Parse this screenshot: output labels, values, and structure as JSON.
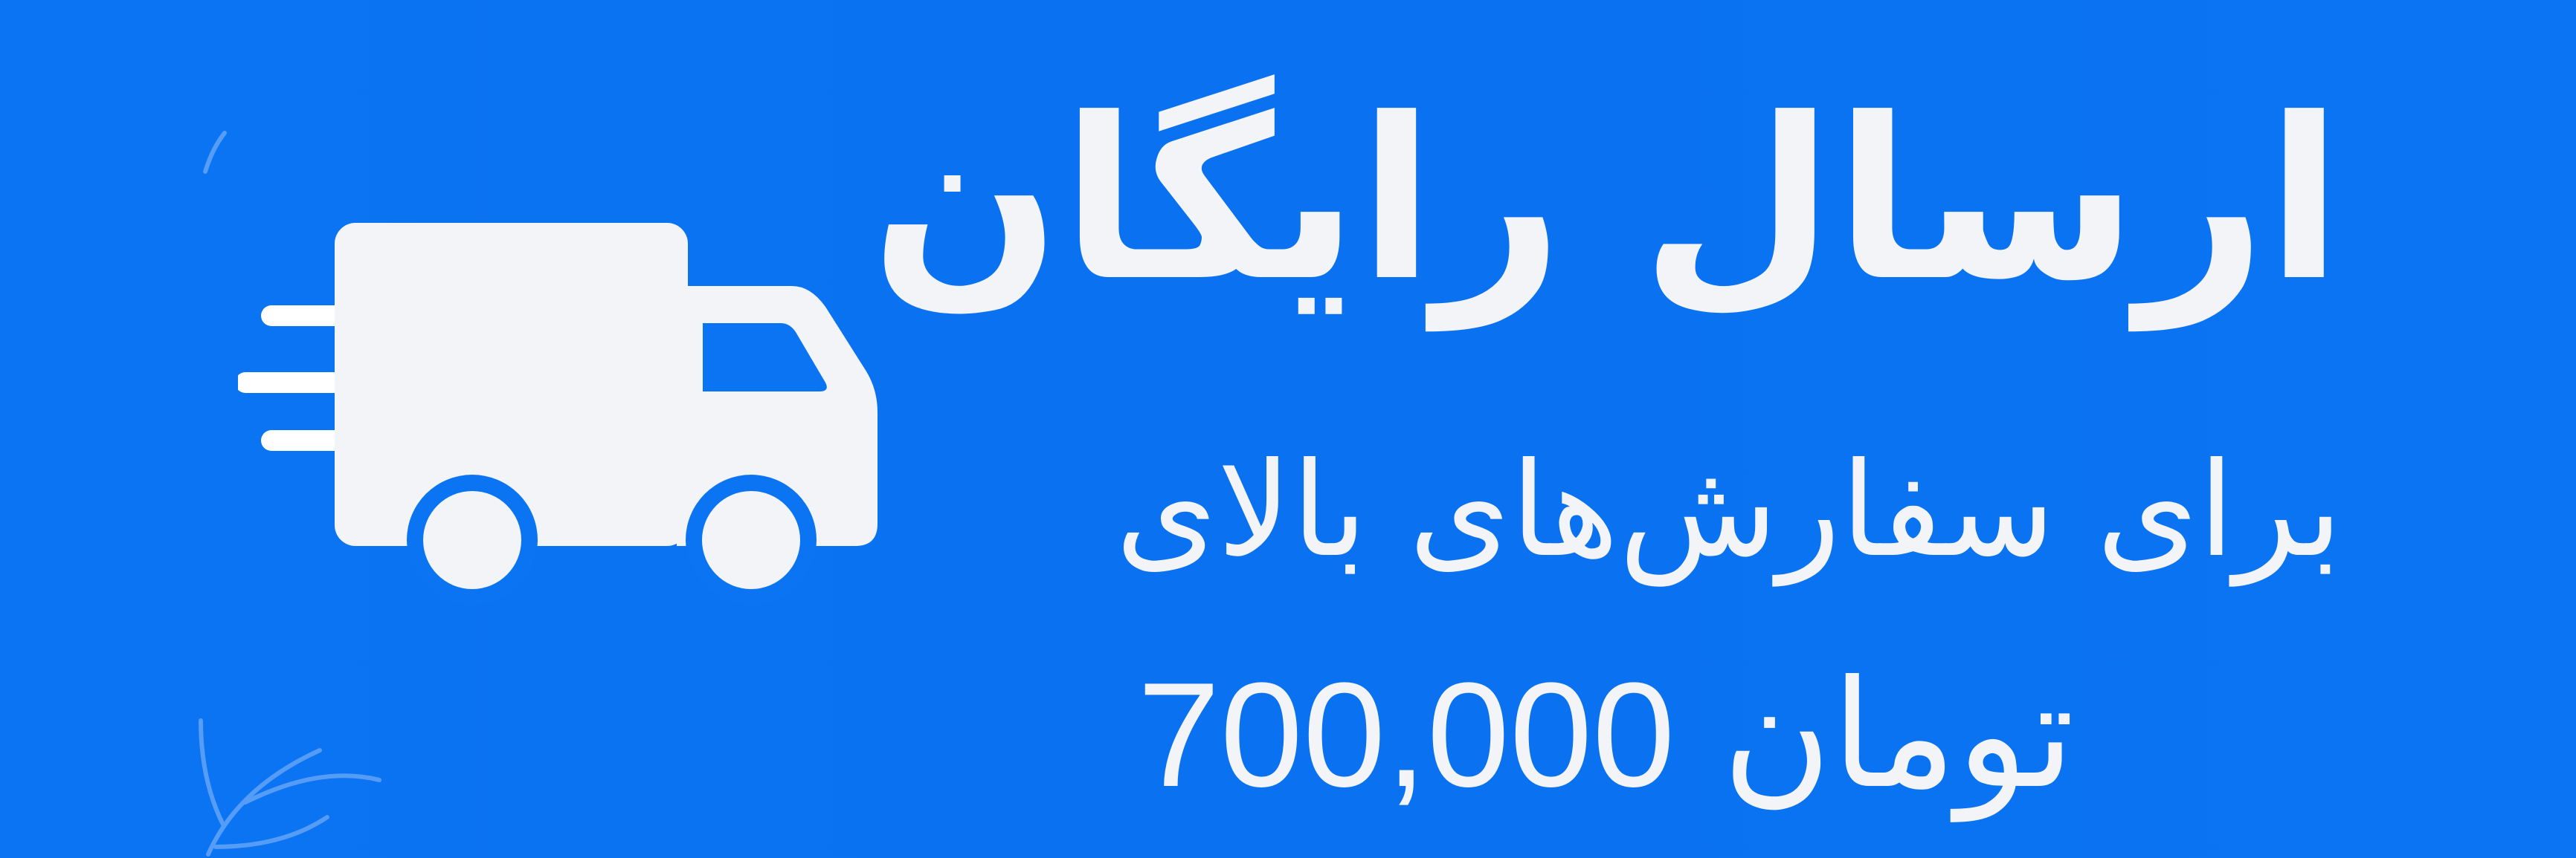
{
  "banner": {
    "headline": "ارسال رایگان",
    "subline": "برای سفارش‌های بالای",
    "amount": "700,000",
    "currency": "تومان"
  },
  "colors": {
    "background": "#0b74f2",
    "foreground": "#f3f4f8"
  },
  "icons": {
    "truck": "delivery-truck-icon",
    "leaf": "leaf-decoration-icon"
  }
}
